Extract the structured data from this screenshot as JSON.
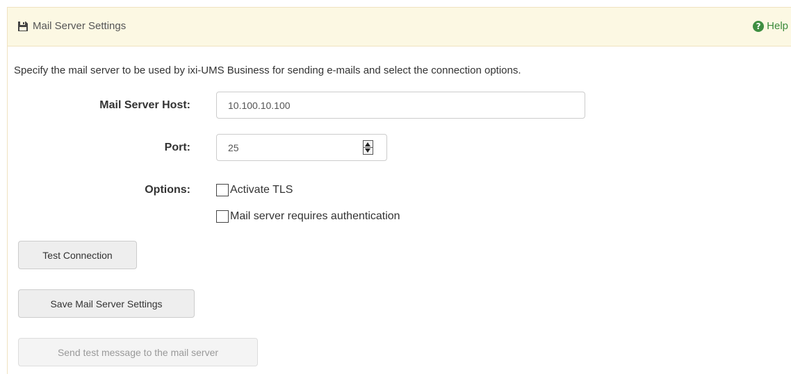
{
  "header": {
    "title": "Mail Server Settings",
    "icon": "save-icon",
    "help_label": "Help",
    "help_icon": "question-circle-icon"
  },
  "description": "Specify the mail server to be used by ixi-UMS Business for sending e-mails and select the connection options.",
  "form": {
    "host_label": "Mail Server Host:",
    "host_value": "10.100.10.100",
    "port_label": "Port:",
    "port_value": "25",
    "options_label": "Options:",
    "options": [
      {
        "label": "Activate TLS",
        "checked": false
      },
      {
        "label": "Mail server requires authentication",
        "checked": false
      }
    ]
  },
  "buttons": {
    "test_connection": "Test Connection",
    "save_settings": "Save Mail Server Settings",
    "send_test": "Send test message to the mail server"
  },
  "colors": {
    "header_bg": "#fcf8e3",
    "help_green": "#3e8e41",
    "disabled_text": "#999999"
  }
}
